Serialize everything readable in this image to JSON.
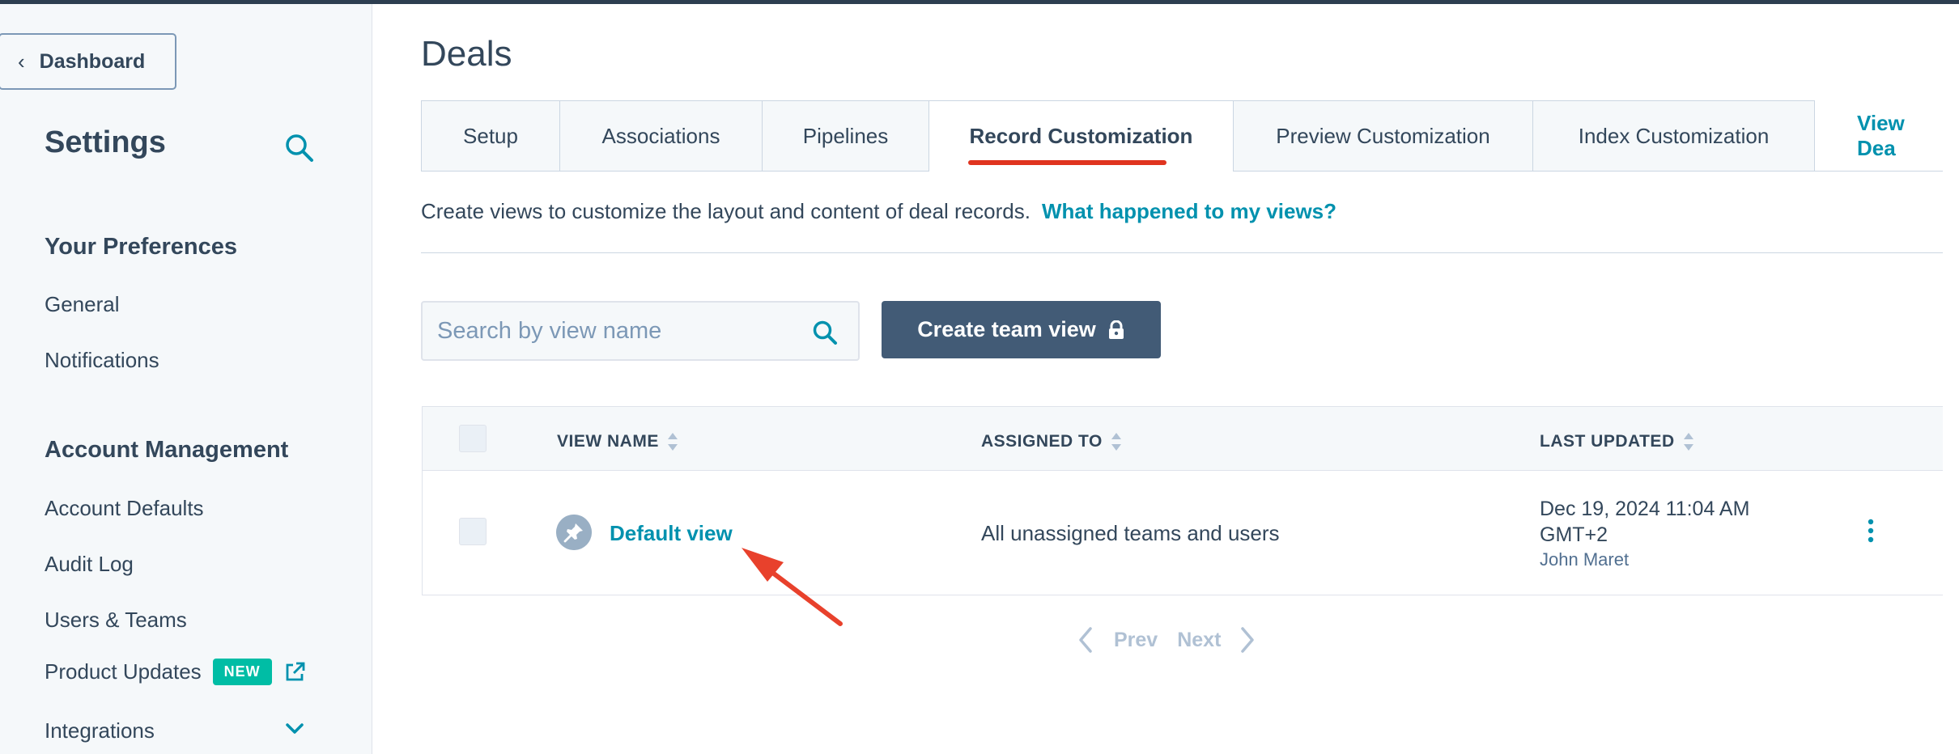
{
  "sidebar": {
    "back_label": "Dashboard",
    "title": "Settings",
    "sections": [
      {
        "heading": "Your Preferences",
        "items": [
          "General",
          "Notifications"
        ]
      },
      {
        "heading": "Account Management",
        "items": [
          "Account Defaults",
          "Audit Log",
          "Users & Teams",
          "Product Updates",
          "Integrations"
        ]
      }
    ],
    "product_updates_badge": "NEW"
  },
  "main": {
    "title": "Deals",
    "tabs": [
      {
        "label": "Setup",
        "active": false
      },
      {
        "label": "Associations",
        "active": false
      },
      {
        "label": "Pipelines",
        "active": false
      },
      {
        "label": "Record Customization",
        "active": true
      },
      {
        "label": "Preview Customization",
        "active": false
      },
      {
        "label": "Index Customization",
        "active": false
      },
      {
        "label": "View Dea"
      }
    ],
    "description": "Create views to customize the layout and content of deal records.",
    "help_link": "What happened to my views?",
    "search_placeholder": "Search by view name",
    "create_button": "Create team view",
    "table": {
      "columns": [
        "VIEW NAME",
        "ASSIGNED TO",
        "LAST UPDATED"
      ],
      "rows": [
        {
          "view_name": "Default view",
          "assigned_to": "All unassigned teams and users",
          "last_updated": "Dec 19, 2024 11:04 AM GMT+2",
          "updated_by": "John Maret"
        }
      ]
    },
    "pagination": {
      "prev": "Prev",
      "next": "Next"
    }
  },
  "colors": {
    "accent_link": "#0091ae",
    "primary_button": "#425b76",
    "active_tab_underline": "#e0341f",
    "badge_new": "#00bda5",
    "annotation_arrow": "#e8412c"
  },
  "icons": [
    "chevron-left-icon",
    "search-icon",
    "external-link-icon",
    "chevron-down-icon",
    "lock-icon",
    "sort-icon",
    "pin-icon",
    "kebab-menu-icon",
    "chevron-right-icon"
  ]
}
